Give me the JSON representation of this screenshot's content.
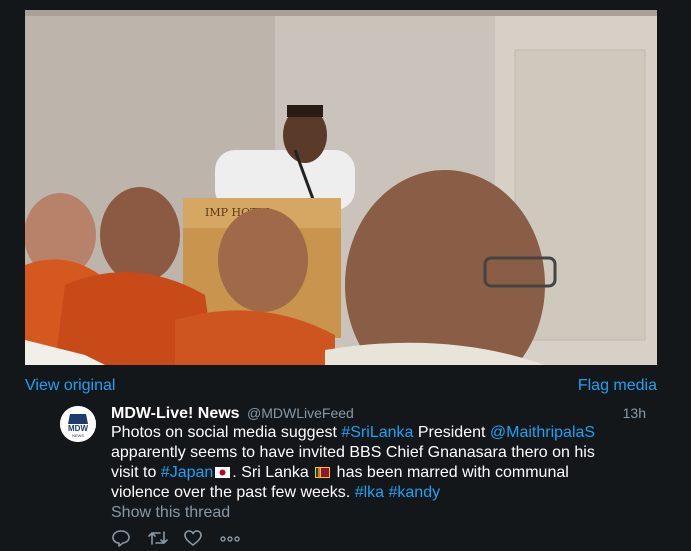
{
  "media": {
    "view_original": "View original",
    "flag_media": "Flag media",
    "photo_sign_text": "IMP   HOTEL"
  },
  "tweet": {
    "avatar_text": "MDW",
    "avatar_subtext": "NEWS",
    "name": "MDW-Live! News",
    "handle": "@MDWLiveFeed",
    "time": "13h",
    "segments": [
      {
        "t": "Photos on social media suggest ",
        "link": false
      },
      {
        "t": "#SriLanka",
        "link": true
      },
      {
        "t": " President ",
        "link": false
      },
      {
        "t": "@MaithripalaS",
        "link": true
      },
      {
        "t": " apparently seems to have invited BBS Chief Gnanasara thero on his visit to ",
        "link": false
      },
      {
        "t": "#Japan",
        "link": true
      },
      {
        "t": "FLAG_JP",
        "link": false
      },
      {
        "t": ". Sri Lanka ",
        "link": false
      },
      {
        "t": "FLAG_LK",
        "link": false
      },
      {
        "t": " has been marred with communal violence over the past few weeks. ",
        "link": false
      },
      {
        "t": "#lka",
        "link": true
      },
      {
        "t": " ",
        "link": false
      },
      {
        "t": "#kandy",
        "link": true
      }
    ],
    "show_thread": "Show this thread"
  },
  "icons": [
    "reply-icon",
    "retweet-icon",
    "like-icon",
    "more-icon"
  ],
  "colors": {
    "background": "#14171a",
    "link": "#1da1f2",
    "muted": "#8899a6",
    "text": "#ffffff"
  }
}
